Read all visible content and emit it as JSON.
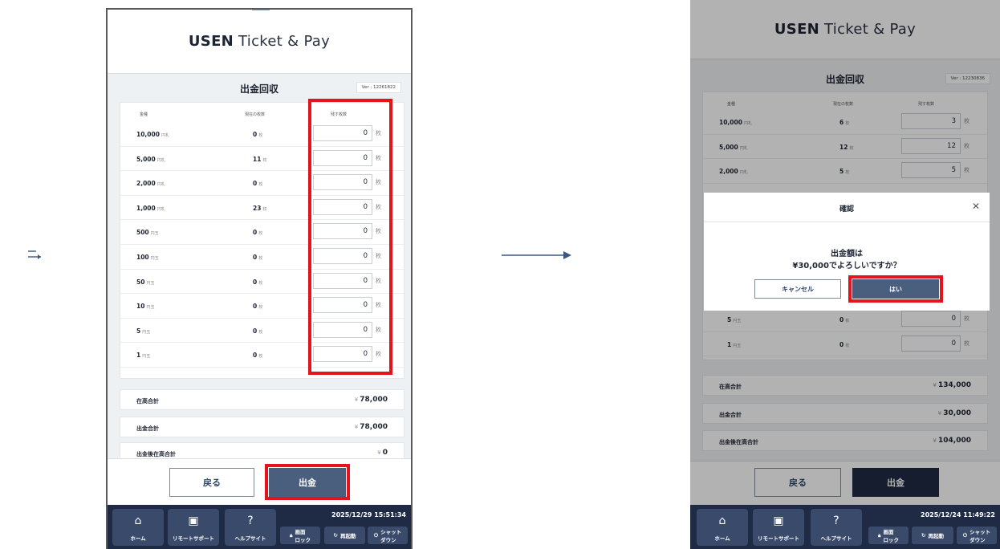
{
  "app": {
    "brand_bold": "USEN",
    "brand_light": "Ticket & Pay"
  },
  "colors": {
    "accent": "#4a5e7d",
    "highlight": "#e5131b",
    "bottom_bar": "#1f2a44",
    "nav_button": "#3a4a6b"
  },
  "left": {
    "page_title": "出金回収",
    "version": "Ver : 12261822",
    "table": {
      "headers": [
        "金種",
        "現在の枚数",
        "残す枚数"
      ],
      "count_unit": "枚",
      "rows": [
        {
          "value": "10,000",
          "kind": "円札",
          "count": "0",
          "remain": "0"
        },
        {
          "value": "5,000",
          "kind": "円札",
          "count": "11",
          "remain": "0"
        },
        {
          "value": "2,000",
          "kind": "円札",
          "count": "0",
          "remain": "0"
        },
        {
          "value": "1,000",
          "kind": "円札",
          "count": "23",
          "remain": "0"
        },
        {
          "value": "500",
          "kind": "円玉",
          "count": "0",
          "remain": "0"
        },
        {
          "value": "100",
          "kind": "円玉",
          "count": "0",
          "remain": "0"
        },
        {
          "value": "50",
          "kind": "円玉",
          "count": "0",
          "remain": "0"
        },
        {
          "value": "10",
          "kind": "円玉",
          "count": "0",
          "remain": "0"
        },
        {
          "value": "5",
          "kind": "円玉",
          "count": "0",
          "remain": "0"
        },
        {
          "value": "1",
          "kind": "円玉",
          "count": "0",
          "remain": "0"
        }
      ]
    },
    "summary": {
      "stock_total_label": "在高合計",
      "stock_total": "78,000",
      "withdraw_total_label": "出金合計",
      "withdraw_total": "78,000",
      "after_total_label": "出金後在高合計",
      "after_total": "0"
    },
    "buttons": {
      "back": "戻る",
      "withdraw": "出金"
    },
    "datetime": "2025/12/29 15:51:34"
  },
  "right": {
    "page_title": "出金回収",
    "version": "Ver : 12230836",
    "table": {
      "headers": [
        "金種",
        "現在の枚数",
        "残す枚数"
      ],
      "rows_top": [
        {
          "value": "10,000",
          "kind": "円札",
          "count": "6",
          "remain": "3"
        },
        {
          "value": "5,000",
          "kind": "円札",
          "count": "12",
          "remain": "12"
        },
        {
          "value": "2,000",
          "kind": "円札",
          "count": "5",
          "remain": "5"
        }
      ],
      "rows_bottom": [
        {
          "value": "5",
          "kind": "円玉",
          "count": "0",
          "remain": "0"
        },
        {
          "value": "1",
          "kind": "円玉",
          "count": "0",
          "remain": "0"
        }
      ]
    },
    "summary": {
      "stock_total": "134,000",
      "withdraw_total": "30,000",
      "after_total": "104,000"
    },
    "dialog": {
      "title": "確認",
      "message_line1": "出金額は",
      "message_line2": "¥30,000でよろしいですか？",
      "cancel": "キャンセル",
      "ok": "はい"
    },
    "datetime": "2025/12/24 11:49:22"
  },
  "nav": {
    "home": "ホーム",
    "remote": "リモートサポート",
    "help": "ヘルプサイト",
    "lock_line1": "画面",
    "lock_line2": "ロック",
    "restart": "再起動",
    "shutdown_line1": "シャット",
    "shutdown_line2": "ダウン"
  },
  "icons": {
    "home": "home-icon",
    "remote": "remote-support-icon",
    "help": "question-icon",
    "lock": "lock-icon",
    "restart": "restart-icon",
    "power": "power-icon",
    "close": "close-icon",
    "arrow_return": "arrow-return-icon",
    "arrow_right": "arrow-right-icon"
  },
  "yen": "¥"
}
